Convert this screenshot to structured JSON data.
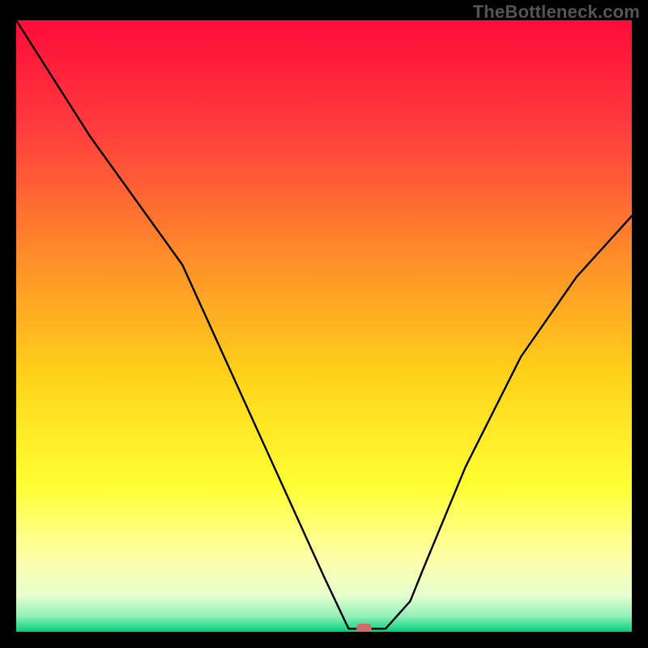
{
  "watermark": "TheBottleneck.com",
  "chart_data": {
    "type": "line",
    "title": "",
    "xlabel": "",
    "ylabel": "",
    "xlim": [
      0,
      100
    ],
    "ylim": [
      0,
      100
    ],
    "grid": false,
    "legend": false,
    "series": [
      {
        "name": "bottleneck-curve",
        "x": [
          0,
          12,
          27,
          50,
          54,
          56,
          60,
          64,
          66,
          73,
          82,
          91,
          100
        ],
        "y": [
          100,
          81,
          60,
          9,
          0.5,
          0.5,
          0.5,
          5,
          10,
          27,
          45,
          58,
          68
        ]
      }
    ],
    "marker": {
      "name": "optimal-point",
      "x": 56.5,
      "y": 0.6,
      "color": "#d36a6a",
      "shape": "rounded-rect"
    },
    "background_gradient": {
      "stops": [
        {
          "offset": 0.0,
          "color": "#ff0b3a"
        },
        {
          "offset": 0.18,
          "color": "#ff3d3d"
        },
        {
          "offset": 0.38,
          "color": "#ff8a2a"
        },
        {
          "offset": 0.58,
          "color": "#ffd21a"
        },
        {
          "offset": 0.76,
          "color": "#ffff33"
        },
        {
          "offset": 0.88,
          "color": "#ffffaa"
        },
        {
          "offset": 0.94,
          "color": "#e8ffd0"
        },
        {
          "offset": 0.975,
          "color": "#8ff0b8"
        },
        {
          "offset": 1.0,
          "color": "#00d07a"
        }
      ]
    }
  }
}
